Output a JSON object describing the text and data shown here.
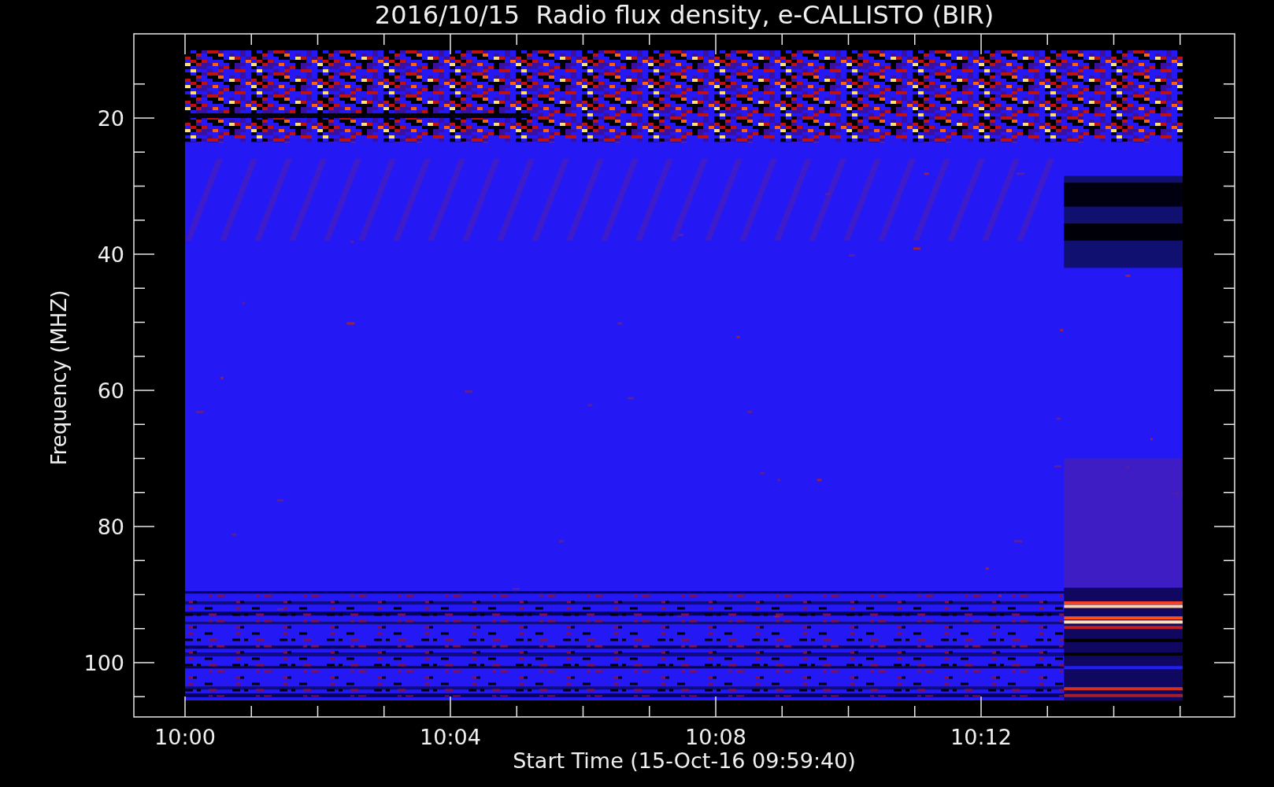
{
  "title": "2016/10/15  Radio flux density, e-CALLISTO (BIR)",
  "y_axis": {
    "label": "Frequency (MHZ)",
    "ticks": [
      "20",
      "40",
      "60",
      "80",
      "100"
    ]
  },
  "x_axis": {
    "label": "Start Time (15-Oct-16 09:59:40)",
    "ticks": [
      "10:00",
      "10:04",
      "10:08",
      "10:12"
    ]
  }
}
